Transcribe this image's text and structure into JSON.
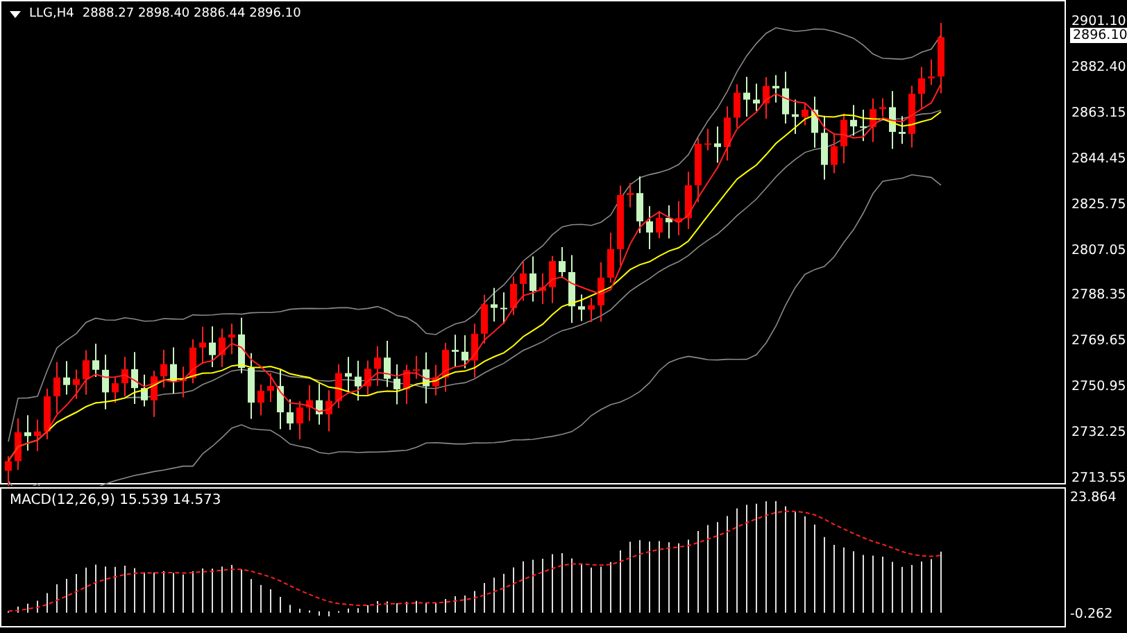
{
  "header": {
    "symbol": "LLG,H4",
    "ohlc": "2888.27 2898.40 2886.44 2896.10"
  },
  "price_axis": {
    "ticks": [
      "2901.10",
      "2882.40",
      "2863.15",
      "2844.45",
      "2825.75",
      "2807.05",
      "2788.35",
      "2769.65",
      "2750.95",
      "2732.25",
      "2713.55"
    ],
    "current_price": "2896.10"
  },
  "macd": {
    "title": "MACD(12,26,9) 15.539 14.573",
    "max_label": "23.864",
    "min_label": "-0.262"
  }
}
